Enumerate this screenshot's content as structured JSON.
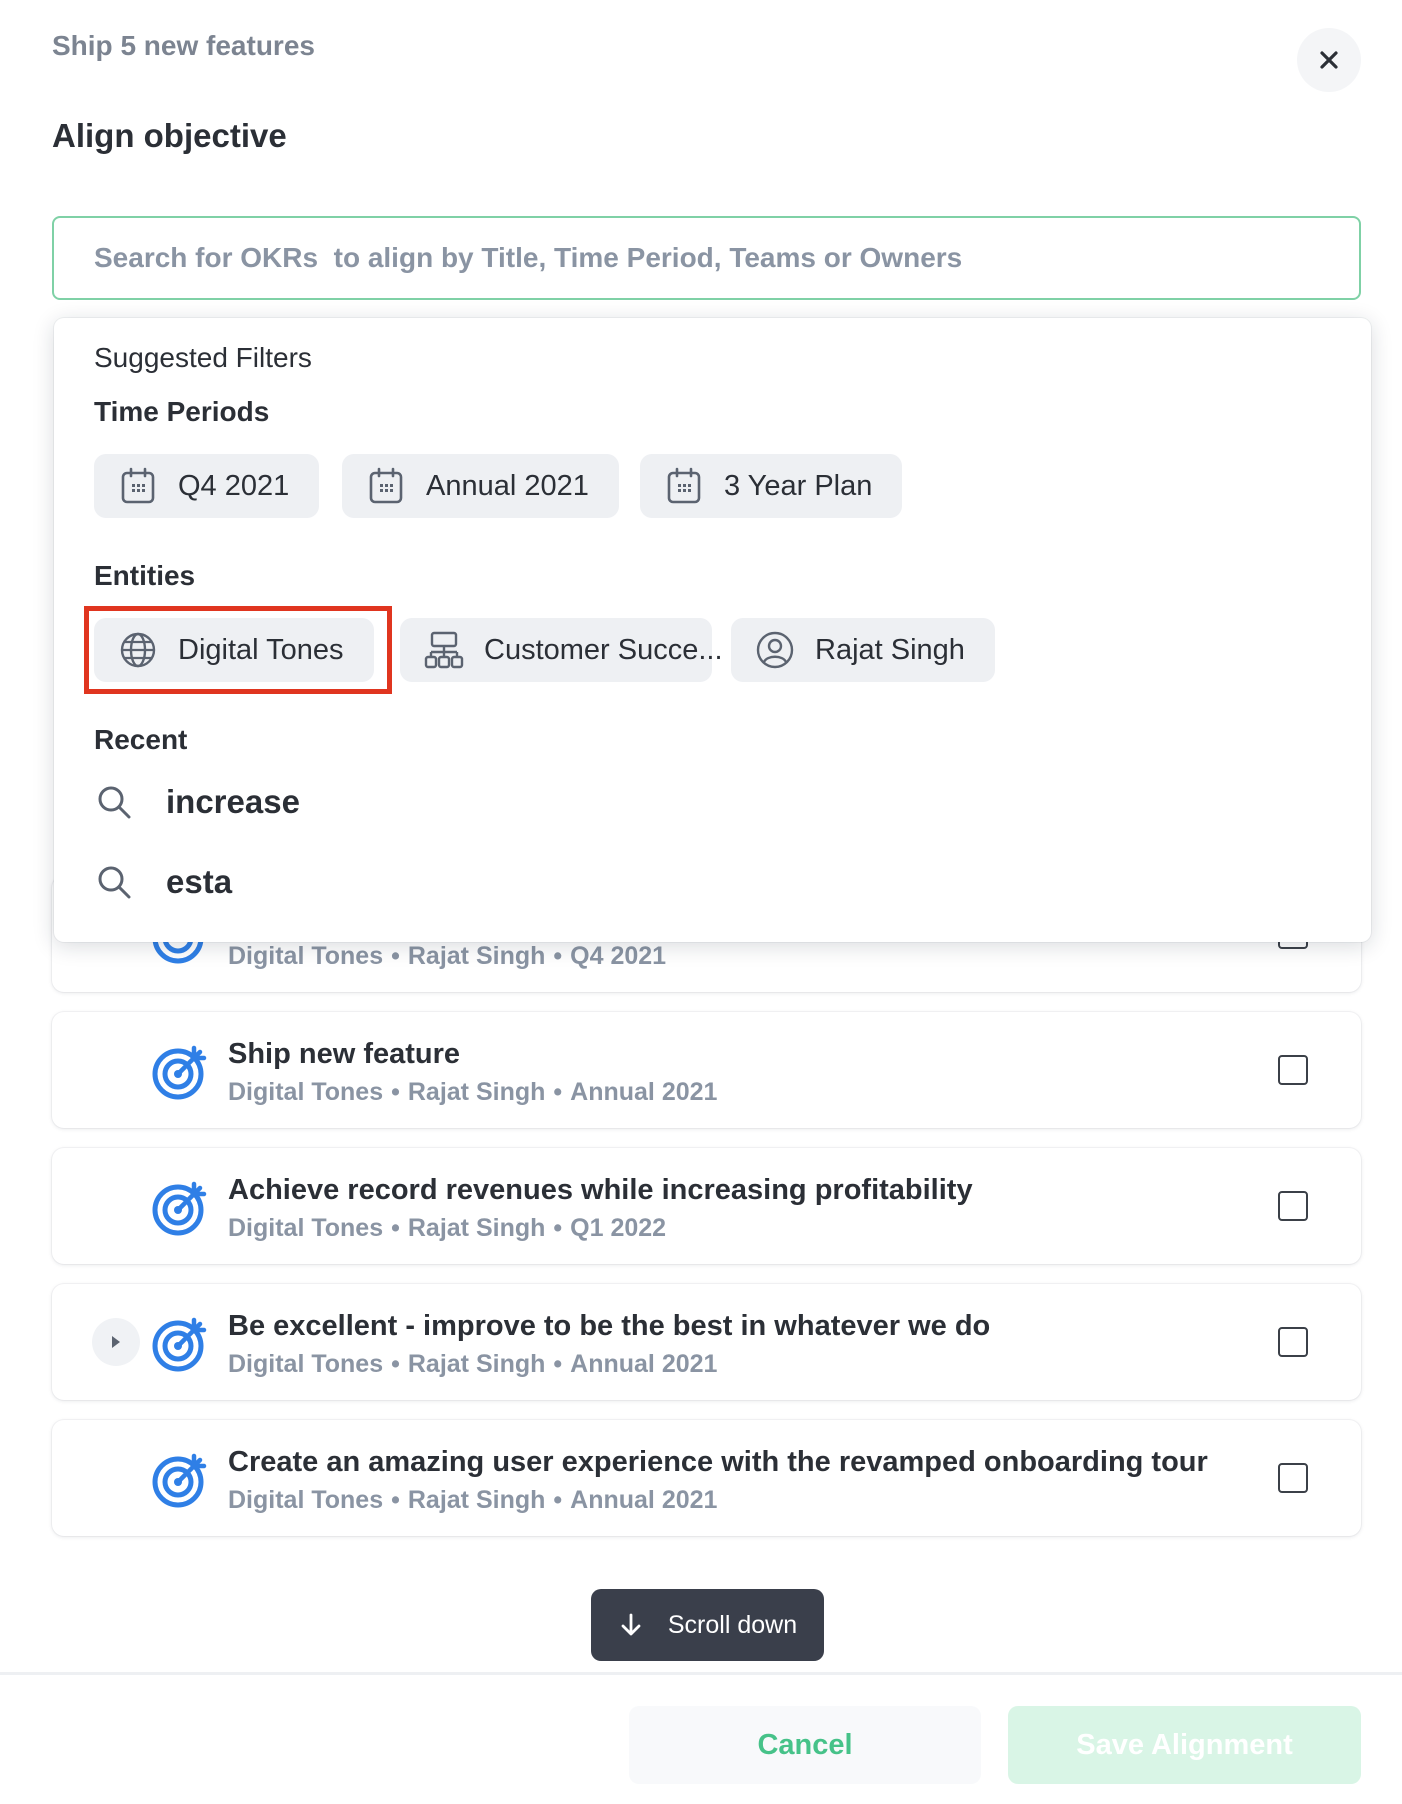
{
  "header": {
    "breadcrumb": "Ship 5 new features",
    "title": "Align objective",
    "close_icon": "close-icon"
  },
  "search": {
    "placeholder": "Search for OKRs  to align by Title, Time Period, Teams or Owners",
    "value": ""
  },
  "dropdown": {
    "heading": "Suggested Filters",
    "time_periods": {
      "label": "Time Periods",
      "chips": [
        {
          "label": "Q4 2021",
          "icon": "calendar-icon"
        },
        {
          "label": "Annual 2021",
          "icon": "calendar-icon"
        },
        {
          "label": "3 Year Plan",
          "icon": "calendar-icon"
        }
      ]
    },
    "entities": {
      "label": "Entities",
      "chips": [
        {
          "label": "Digital Tones",
          "icon": "globe-icon",
          "highlighted": true
        },
        {
          "label": "Customer Succe...",
          "icon": "org-chart-icon"
        },
        {
          "label": "Rajat Singh",
          "icon": "user-icon"
        }
      ]
    },
    "recent": {
      "label": "Recent",
      "items": [
        {
          "label": "increase",
          "icon": "search-icon"
        },
        {
          "label": "esta",
          "icon": "search-icon"
        }
      ]
    },
    "highlight_color": "#e0351f"
  },
  "okr_list": [
    {
      "title": "",
      "team": "Digital Tones",
      "owner": "Rajat Singh",
      "period": "Q4 2021",
      "expandable": false
    },
    {
      "title": "Ship new feature",
      "team": "Digital Tones",
      "owner": "Rajat Singh",
      "period": "Annual 2021",
      "expandable": false
    },
    {
      "title": "Achieve record revenues while increasing profitability",
      "team": "Digital Tones",
      "owner": "Rajat Singh",
      "period": "Q1 2022",
      "expandable": false
    },
    {
      "title": "Be excellent - improve to be the best in whatever we do",
      "team": "Digital Tones",
      "owner": "Rajat Singh",
      "period": "Annual 2021",
      "expandable": true
    },
    {
      "title": "Create an amazing user experience with the revamped onboarding tour",
      "team": "Digital Tones",
      "owner": "Rajat Singh",
      "period": "Annual 2021",
      "expandable": false
    }
  ],
  "meta_separator": "•",
  "scroll_hint": {
    "label": "Scroll down",
    "icon": "arrow-down-icon"
  },
  "footer": {
    "cancel_label": "Cancel",
    "save_label": "Save Alignment"
  },
  "colors": {
    "accent_green": "#46c289",
    "search_border": "#7fd1a6",
    "objective_icon": "#2f7fe6",
    "save_disabled_bg": "#d9f5e6"
  }
}
